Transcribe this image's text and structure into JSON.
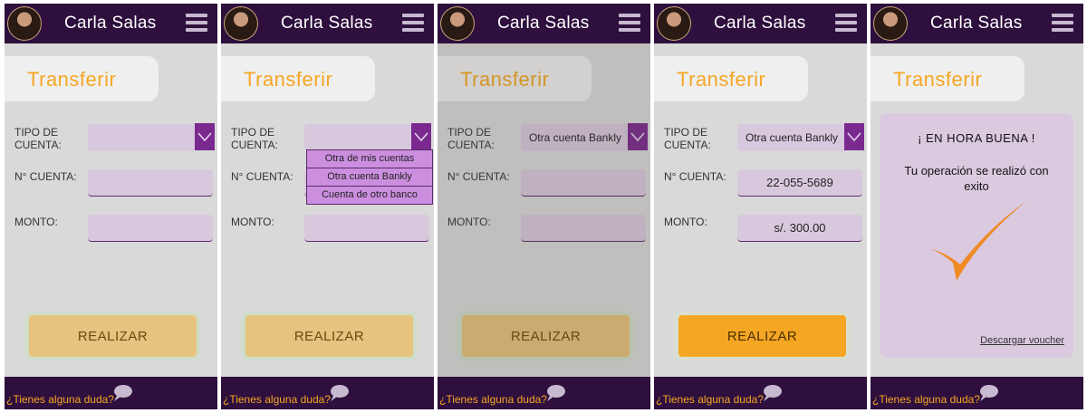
{
  "header": {
    "user_name": "Carla Salas"
  },
  "page": {
    "title": "Transferir"
  },
  "form": {
    "tipo_label": "TIPO DE CUENTA:",
    "cuenta_label": "N° CUENTA:",
    "monto_label": "MONTO:",
    "selected_type": "Otra cuenta Bankly",
    "account_number": "22-055-5689",
    "amount": "s/. 300.00"
  },
  "dropdown": {
    "options": [
      "Otra de mis cuentas",
      "Otra cuenta Bankly",
      "Cuenta de otro banco"
    ]
  },
  "buttons": {
    "submit": "REALIZAR"
  },
  "footer": {
    "question": "¿Tienes alguna duda?"
  },
  "modal": {
    "title": "¡ EN HORA BUENA !",
    "message": "Tu operación se realizó con exito",
    "voucher_link": "Descargar voucher"
  },
  "colors": {
    "header_bg": "#2e0f3d",
    "accent": "#f5a623",
    "field_bg": "#d8c8dd",
    "caret_bg": "#7a2a8f",
    "dropdown_bg": "#cc8fe0"
  }
}
